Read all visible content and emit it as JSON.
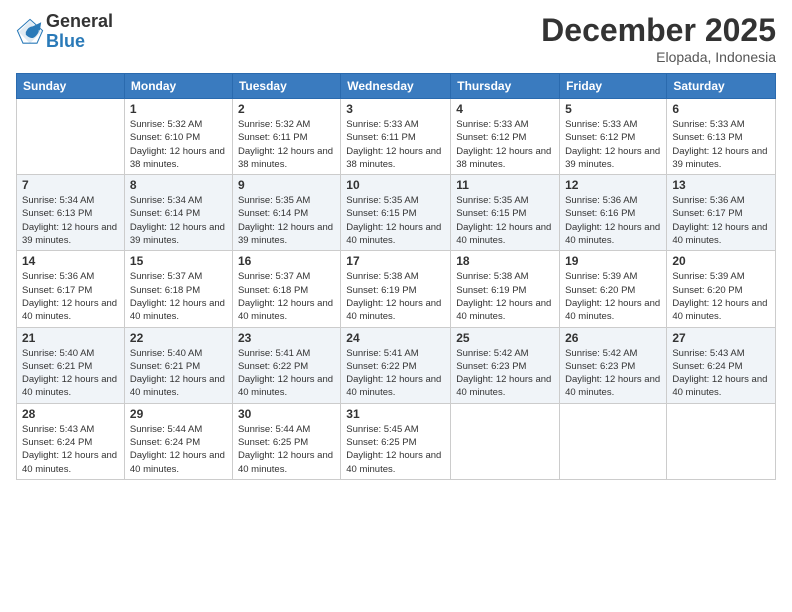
{
  "logo": {
    "general": "General",
    "blue": "Blue"
  },
  "header": {
    "month": "December 2025",
    "location": "Elopada, Indonesia"
  },
  "weekdays": [
    "Sunday",
    "Monday",
    "Tuesday",
    "Wednesday",
    "Thursday",
    "Friday",
    "Saturday"
  ],
  "weeks": [
    [
      {
        "day": "",
        "info": ""
      },
      {
        "day": "1",
        "info": "Sunrise: 5:32 AM\nSunset: 6:10 PM\nDaylight: 12 hours\nand 38 minutes."
      },
      {
        "day": "2",
        "info": "Sunrise: 5:32 AM\nSunset: 6:11 PM\nDaylight: 12 hours\nand 38 minutes."
      },
      {
        "day": "3",
        "info": "Sunrise: 5:33 AM\nSunset: 6:11 PM\nDaylight: 12 hours\nand 38 minutes."
      },
      {
        "day": "4",
        "info": "Sunrise: 5:33 AM\nSunset: 6:12 PM\nDaylight: 12 hours\nand 38 minutes."
      },
      {
        "day": "5",
        "info": "Sunrise: 5:33 AM\nSunset: 6:12 PM\nDaylight: 12 hours\nand 39 minutes."
      },
      {
        "day": "6",
        "info": "Sunrise: 5:33 AM\nSunset: 6:13 PM\nDaylight: 12 hours\nand 39 minutes."
      }
    ],
    [
      {
        "day": "7",
        "info": "Sunrise: 5:34 AM\nSunset: 6:13 PM\nDaylight: 12 hours\nand 39 minutes."
      },
      {
        "day": "8",
        "info": "Sunrise: 5:34 AM\nSunset: 6:14 PM\nDaylight: 12 hours\nand 39 minutes."
      },
      {
        "day": "9",
        "info": "Sunrise: 5:35 AM\nSunset: 6:14 PM\nDaylight: 12 hours\nand 39 minutes."
      },
      {
        "day": "10",
        "info": "Sunrise: 5:35 AM\nSunset: 6:15 PM\nDaylight: 12 hours\nand 40 minutes."
      },
      {
        "day": "11",
        "info": "Sunrise: 5:35 AM\nSunset: 6:15 PM\nDaylight: 12 hours\nand 40 minutes."
      },
      {
        "day": "12",
        "info": "Sunrise: 5:36 AM\nSunset: 6:16 PM\nDaylight: 12 hours\nand 40 minutes."
      },
      {
        "day": "13",
        "info": "Sunrise: 5:36 AM\nSunset: 6:17 PM\nDaylight: 12 hours\nand 40 minutes."
      }
    ],
    [
      {
        "day": "14",
        "info": "Sunrise: 5:36 AM\nSunset: 6:17 PM\nDaylight: 12 hours\nand 40 minutes."
      },
      {
        "day": "15",
        "info": "Sunrise: 5:37 AM\nSunset: 6:18 PM\nDaylight: 12 hours\nand 40 minutes."
      },
      {
        "day": "16",
        "info": "Sunrise: 5:37 AM\nSunset: 6:18 PM\nDaylight: 12 hours\nand 40 minutes."
      },
      {
        "day": "17",
        "info": "Sunrise: 5:38 AM\nSunset: 6:19 PM\nDaylight: 12 hours\nand 40 minutes."
      },
      {
        "day": "18",
        "info": "Sunrise: 5:38 AM\nSunset: 6:19 PM\nDaylight: 12 hours\nand 40 minutes."
      },
      {
        "day": "19",
        "info": "Sunrise: 5:39 AM\nSunset: 6:20 PM\nDaylight: 12 hours\nand 40 minutes."
      },
      {
        "day": "20",
        "info": "Sunrise: 5:39 AM\nSunset: 6:20 PM\nDaylight: 12 hours\nand 40 minutes."
      }
    ],
    [
      {
        "day": "21",
        "info": "Sunrise: 5:40 AM\nSunset: 6:21 PM\nDaylight: 12 hours\nand 40 minutes."
      },
      {
        "day": "22",
        "info": "Sunrise: 5:40 AM\nSunset: 6:21 PM\nDaylight: 12 hours\nand 40 minutes."
      },
      {
        "day": "23",
        "info": "Sunrise: 5:41 AM\nSunset: 6:22 PM\nDaylight: 12 hours\nand 40 minutes."
      },
      {
        "day": "24",
        "info": "Sunrise: 5:41 AM\nSunset: 6:22 PM\nDaylight: 12 hours\nand 40 minutes."
      },
      {
        "day": "25",
        "info": "Sunrise: 5:42 AM\nSunset: 6:23 PM\nDaylight: 12 hours\nand 40 minutes."
      },
      {
        "day": "26",
        "info": "Sunrise: 5:42 AM\nSunset: 6:23 PM\nDaylight: 12 hours\nand 40 minutes."
      },
      {
        "day": "27",
        "info": "Sunrise: 5:43 AM\nSunset: 6:24 PM\nDaylight: 12 hours\nand 40 minutes."
      }
    ],
    [
      {
        "day": "28",
        "info": "Sunrise: 5:43 AM\nSunset: 6:24 PM\nDaylight: 12 hours\nand 40 minutes."
      },
      {
        "day": "29",
        "info": "Sunrise: 5:44 AM\nSunset: 6:24 PM\nDaylight: 12 hours\nand 40 minutes."
      },
      {
        "day": "30",
        "info": "Sunrise: 5:44 AM\nSunset: 6:25 PM\nDaylight: 12 hours\nand 40 minutes."
      },
      {
        "day": "31",
        "info": "Sunrise: 5:45 AM\nSunset: 6:25 PM\nDaylight: 12 hours\nand 40 minutes."
      },
      {
        "day": "",
        "info": ""
      },
      {
        "day": "",
        "info": ""
      },
      {
        "day": "",
        "info": ""
      }
    ]
  ]
}
